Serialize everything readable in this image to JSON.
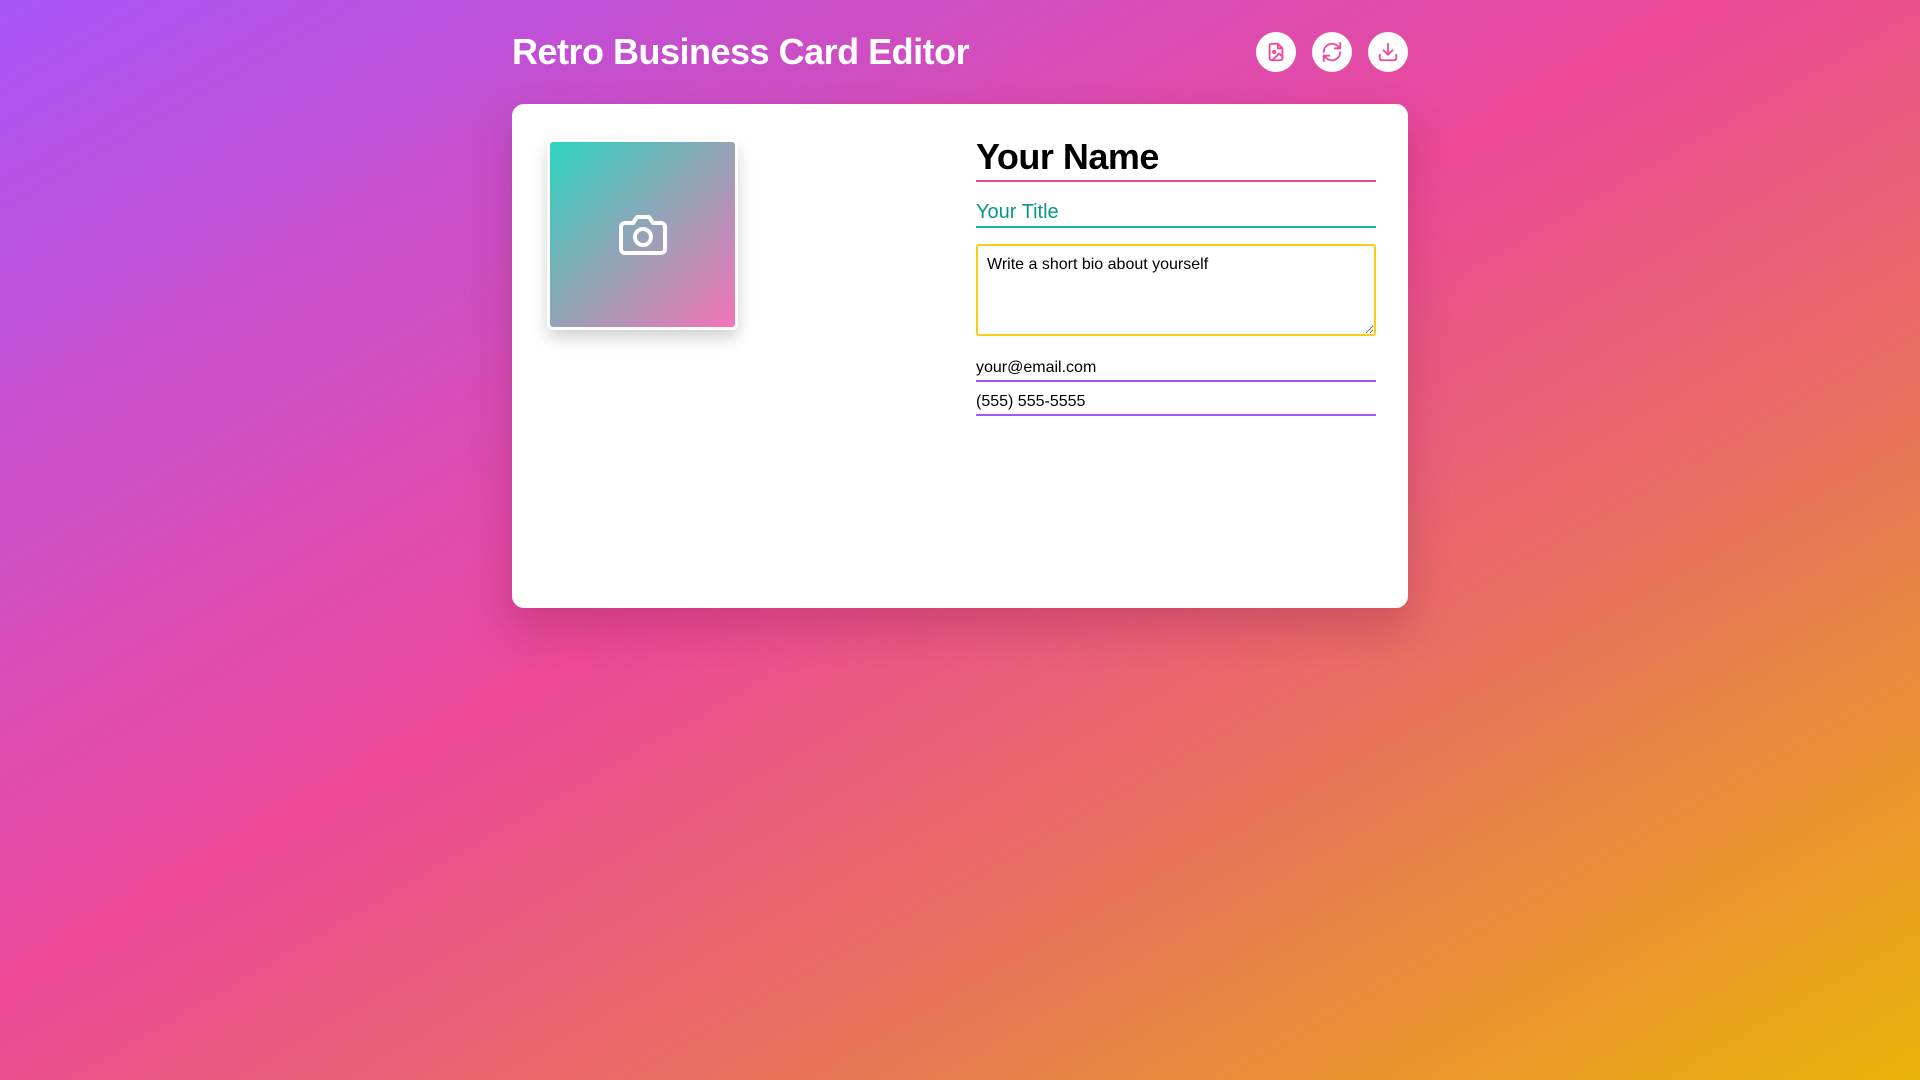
{
  "app": {
    "title": "Retro Business Card Editor"
  },
  "toolbar": {
    "buttons": [
      {
        "icon": "file-image-icon"
      },
      {
        "icon": "refresh-icon"
      },
      {
        "icon": "download-icon"
      }
    ]
  },
  "card": {
    "photo_icon": "camera-icon",
    "name_placeholder": "Your Name",
    "title_placeholder": "Your Title",
    "bio_placeholder": "Write a short bio about yourself",
    "email_placeholder": "your@email.com",
    "phone_placeholder": "(555) 555-5555"
  },
  "colors": {
    "accent_pink": "#ec4899",
    "accent_teal": "#14b8a6",
    "accent_yellow": "#facc15",
    "accent_purple": "#a855f7",
    "background_gradient": [
      "#a855f7",
      "#ec4899",
      "#e8745a",
      "#eab308"
    ]
  }
}
